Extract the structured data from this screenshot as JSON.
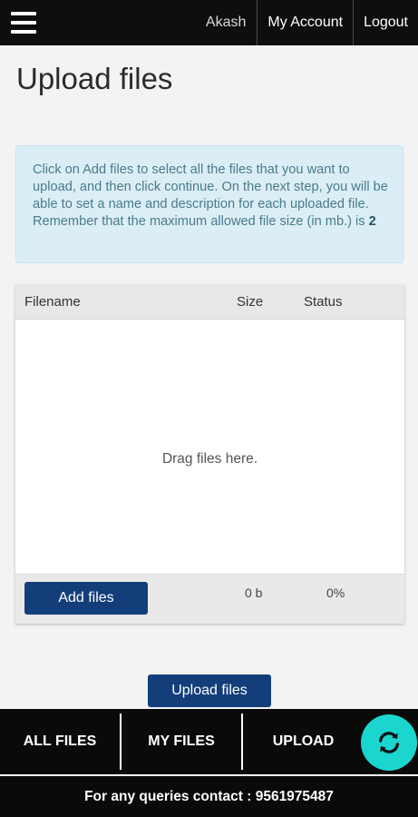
{
  "topbar": {
    "menu_icon": "hamburger-menu-icon",
    "user_name": "Akash",
    "my_account_label": "My Account",
    "logout_label": "Logout"
  },
  "page": {
    "title": "Upload files"
  },
  "info": {
    "text": "Click on Add files to select all the files that you want to upload, and then click continue. On the next step, you will be able to set a name and description for each uploaded file. Remember that the maximum allowed file size (in mb.) is ",
    "max_size": "2"
  },
  "uploader": {
    "columns": [
      "Filename",
      "Size",
      "Status"
    ],
    "drop_text": "Drag files here.",
    "add_files_label": "Add files",
    "total_size": "0 b",
    "total_percent": "0%"
  },
  "actions": {
    "upload_files_label": "Upload files"
  },
  "tabs": [
    {
      "label": "ALL FILES"
    },
    {
      "label": "MY FILES"
    },
    {
      "label": "UPLOAD"
    }
  ],
  "fab": {
    "icon": "refresh-icon",
    "color": "#1bd6cf"
  },
  "footer": {
    "contact_text": "For any queries contact : 9561975487"
  },
  "colors": {
    "topbar": "#0e0d0f",
    "button": "#133e7a",
    "info_bg": "#dbeef6"
  }
}
